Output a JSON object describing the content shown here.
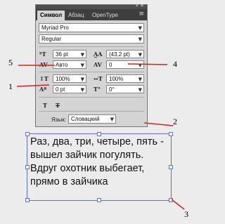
{
  "panel": {
    "tabs": [
      "Символ",
      "Абзац",
      "OpenType"
    ],
    "font_family": "Myriad Pro",
    "font_style": "Regular",
    "font_size": "36 pt",
    "leading": "(43,2 pt)",
    "kerning": "Авто",
    "tracking": "0",
    "vertical_scale": "100%",
    "horizontal_scale": "100%",
    "baseline_shift": "0 pt",
    "rotation": "0°",
    "language_label": "Язык:",
    "language_value": "Словацкий"
  },
  "body_text": "Раз, два, три, четыре, пять - вышел зайчик погулять. Вдруг охотник выбегает, прямо в зайчика",
  "annotations": [
    "1",
    "2",
    "3",
    "4",
    "5"
  ]
}
